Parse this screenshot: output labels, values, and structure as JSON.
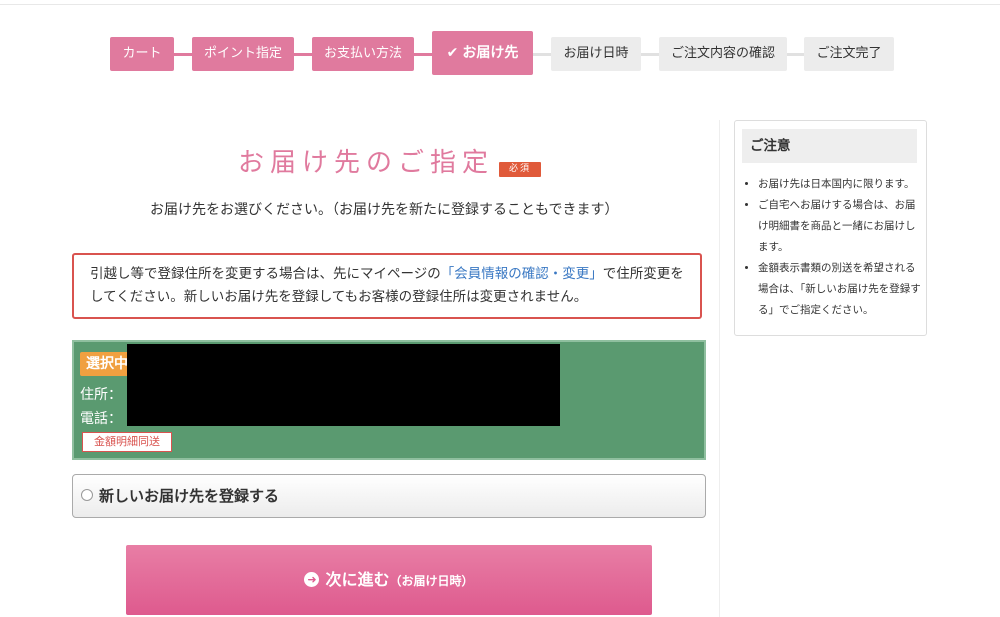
{
  "steps": [
    {
      "label": "カート",
      "state": "done"
    },
    {
      "label": "ポイント指定",
      "state": "done"
    },
    {
      "label": "お支払い方法",
      "state": "done"
    },
    {
      "label": "お届け先",
      "state": "active"
    },
    {
      "label": "お届け日時",
      "state": "todo"
    },
    {
      "label": "ご注文内容の確認",
      "state": "todo"
    },
    {
      "label": "ご注文完了",
      "state": "todo"
    }
  ],
  "page": {
    "title": "お届け先のご指定",
    "required_badge": "必須",
    "subtitle": "お届け先をお選びください。（お届け先を新たに登録することもできます）"
  },
  "notice": {
    "before_link": "引越し等で登録住所を変更する場合は、先にマイページの",
    "link": "「会員情報の確認・変更」",
    "after_link": "で住所変更をしてください。新しいお届け先を登録してもお客様の登録住所は変更されません。"
  },
  "selected_address": {
    "badge": "選択中",
    "address_label": "住所：",
    "tel_label": "電話：",
    "tag": "金額明細同送"
  },
  "new_address": {
    "label": "新しいお届け先を登録する"
  },
  "next_button": {
    "label": "次に進む",
    "sub": "（お届け日時）"
  },
  "sidebar": {
    "heading": "ご注意",
    "items": [
      "お届け先は日本国内に限ります。",
      "ご自宅へお届けする場合は、お届け明細書を商品と一緒にお届けします。",
      "金額表示書類の別送を希望される場合は、「新しいお届け先を登録する」でご指定ください。"
    ]
  },
  "colors": {
    "accent": "#e07a9e",
    "selected_bg": "#5a9a70",
    "badge": "#f0a040",
    "error": "#d9534f",
    "link": "#3a78c3"
  }
}
